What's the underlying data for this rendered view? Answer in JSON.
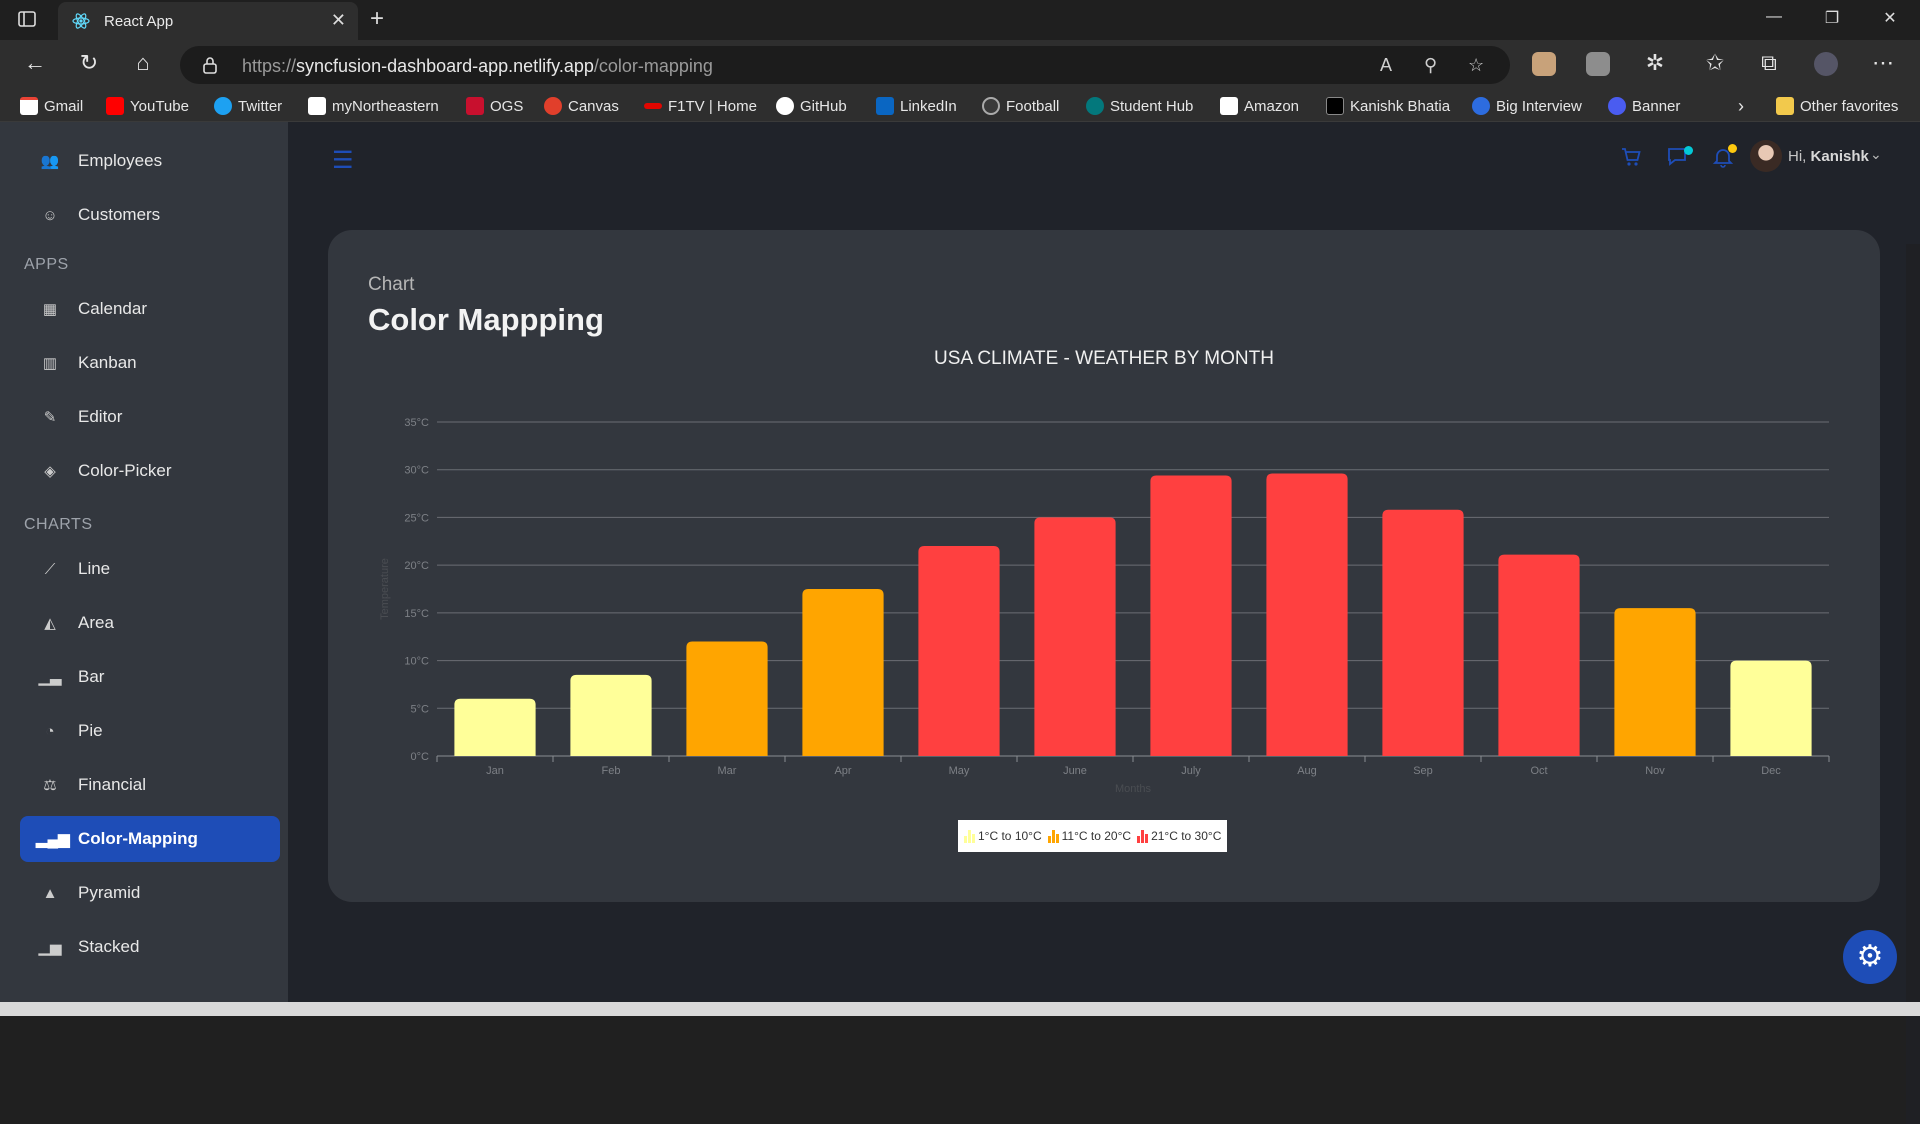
{
  "browser": {
    "tab_title": "React App",
    "url_scheme": "https://",
    "url_host": "syncfusion-dashboard-app.netlify.app",
    "url_path": "/color-mapping"
  },
  "bookmarks": [
    "Gmail",
    "YouTube",
    "Twitter",
    "myNortheastern",
    "OGS",
    "Canvas",
    "F1TV | Home",
    "GitHub",
    "LinkedIn",
    "Football",
    "Student Hub",
    "Amazon",
    "Kanishk Bhatia",
    "Big Interview",
    "Banner"
  ],
  "bookmarks_other": "Other favorites",
  "sidebar": {
    "items_top": [
      {
        "label": "Employees"
      },
      {
        "label": "Customers"
      }
    ],
    "apps_heading": "APPS",
    "apps": [
      {
        "label": "Calendar"
      },
      {
        "label": "Kanban"
      },
      {
        "label": "Editor"
      },
      {
        "label": "Color-Picker"
      }
    ],
    "charts_heading": "CHARTS",
    "charts": [
      {
        "label": "Line"
      },
      {
        "label": "Area"
      },
      {
        "label": "Bar"
      },
      {
        "label": "Pie"
      },
      {
        "label": "Financial"
      },
      {
        "label": "Color-Mapping"
      },
      {
        "label": "Pyramid"
      },
      {
        "label": "Stacked"
      }
    ],
    "active": "Color-Mapping"
  },
  "header": {
    "greeting": "Hi,",
    "user": "Kanishk"
  },
  "page": {
    "subtitle": "Chart",
    "title": "Color Mappping"
  },
  "chart_data": {
    "type": "bar",
    "title": "USA CLIMATE - WEATHER BY MONTH",
    "categories": [
      "Jan",
      "Feb",
      "Mar",
      "Apr",
      "May",
      "June",
      "July",
      "Aug",
      "Sep",
      "Oct",
      "Nov",
      "Dec"
    ],
    "values": [
      6,
      8.5,
      12,
      17.5,
      22,
      25,
      29.4,
      29.6,
      25.8,
      21.1,
      15.5,
      10
    ],
    "ylim": [
      0,
      35
    ],
    "yticks": [
      "0°C",
      "5°C",
      "10°C",
      "15°C",
      "20°C",
      "25°C",
      "30°C",
      "35°C"
    ],
    "ylabel": "Temperature",
    "xlabel": "Months",
    "grid": true,
    "legend_position": "bottom",
    "color_ranges": [
      {
        "label": "1°C to 10°C",
        "start": 1,
        "end": 10,
        "color": "#FFFF99"
      },
      {
        "label": "11°C to 20°C",
        "start": 11,
        "end": 20,
        "color": "#FFA500"
      },
      {
        "label": "21°C to 30°C",
        "start": 21,
        "end": 30,
        "color": "#FF4040"
      }
    ]
  }
}
